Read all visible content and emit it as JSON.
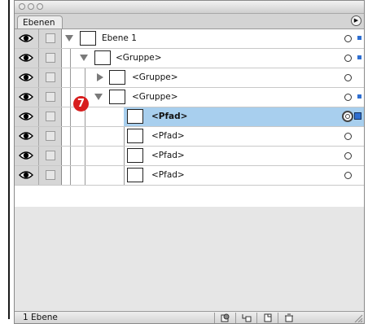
{
  "panel": {
    "tab_label": "Ebenen",
    "menu_icon": "panel-menu-icon",
    "badge_number": "7",
    "layer_count": "1 Ebene"
  },
  "rows": [
    {
      "label": "Ebene 1",
      "kind": "layer",
      "expand": "down",
      "visible": true,
      "selected": false,
      "selection_square": true
    },
    {
      "label": "<Gruppe>",
      "kind": "group",
      "expand": "down",
      "visible": true,
      "selected": false,
      "selection_square": true
    },
    {
      "label": "<Gruppe>",
      "kind": "group",
      "expand": "right",
      "visible": true,
      "selected": false,
      "selection_square": false
    },
    {
      "label": "<Gruppe>",
      "kind": "group",
      "expand": "down",
      "visible": true,
      "selected": false,
      "selection_square": true
    },
    {
      "label": "<Pfad>",
      "kind": "path",
      "expand": "none",
      "visible": true,
      "selected": true,
      "selection_square": true
    },
    {
      "label": "<Pfad>",
      "kind": "path",
      "expand": "none",
      "visible": true,
      "selected": false,
      "selection_square": false
    },
    {
      "label": "<Pfad>",
      "kind": "path",
      "expand": "none",
      "visible": true,
      "selected": false,
      "selection_square": false
    },
    {
      "label": "<Pfad>",
      "kind": "path",
      "expand": "none",
      "visible": true,
      "selected": false,
      "selection_square": false
    }
  ],
  "bottom_buttons": [
    {
      "name": "make-clipping-mask-icon"
    },
    {
      "name": "new-sublayer-icon"
    },
    {
      "name": "new-layer-icon"
    },
    {
      "name": "trash-icon"
    }
  ],
  "colors": {
    "selection_bg": "#a8cfee",
    "selection_square": "#2f6fd1",
    "badge": "#d81e1e"
  }
}
